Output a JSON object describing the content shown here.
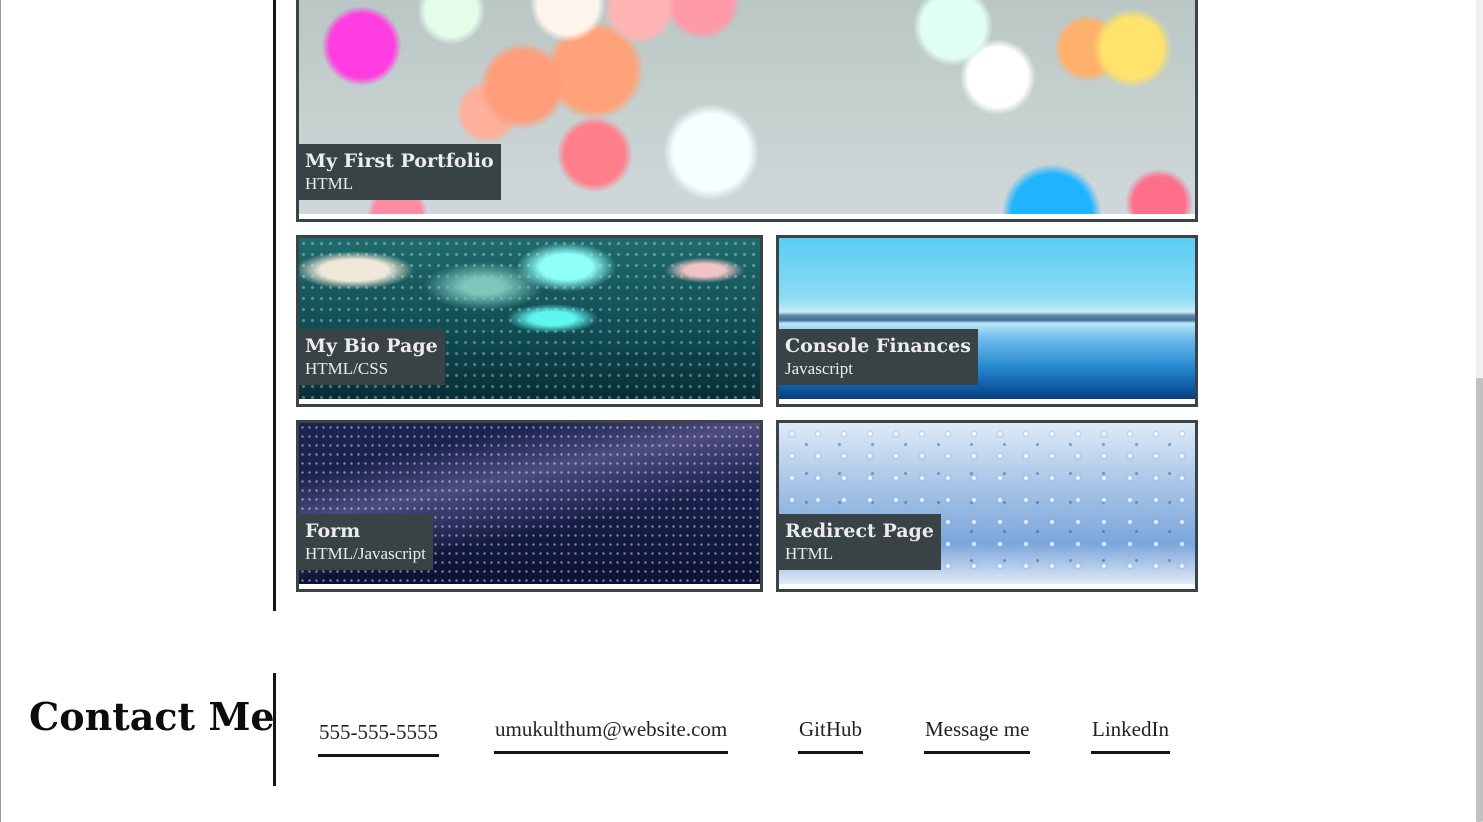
{
  "work": {
    "projects": [
      {
        "title": "My First Portfolio",
        "tech": "HTML",
        "image": "bokeh-lights"
      },
      {
        "title": "My Bio Page",
        "tech": "HTML/CSS",
        "image": "rain-on-glass-teal"
      },
      {
        "title": "Console Finances",
        "tech": "Javascript",
        "image": "blue-lake"
      },
      {
        "title": "Form",
        "tech": "HTML/Javascript",
        "image": "night-sky-galaxy"
      },
      {
        "title": "Redirect Page",
        "tech": "HTML",
        "image": "water-drops-blue"
      }
    ]
  },
  "contact": {
    "heading": "Contact Me",
    "links": [
      {
        "label": "555-555-5555"
      },
      {
        "label": "umukulthum@website.com"
      },
      {
        "label": "GitHub"
      },
      {
        "label": "Message me"
      },
      {
        "label": "LinkedIn"
      }
    ]
  },
  "colors": {
    "caption_bg": "#394244",
    "caption_text": "#ececec",
    "card_border": "#3a4348",
    "rule": "#11151a",
    "page_bg": "#ffffff"
  }
}
